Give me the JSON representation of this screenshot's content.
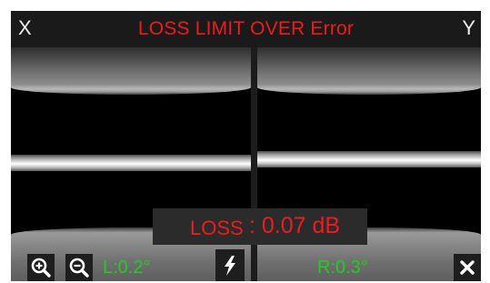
{
  "header": {
    "left_axis": "X",
    "right_axis": "Y",
    "error_title": "LOSS LIMIT OVER Error"
  },
  "loss": {
    "label": "LOSS",
    "value": ": 0.07 dB"
  },
  "bottom": {
    "left_angle": "L:0.2°",
    "right_angle": "R:0.3°"
  },
  "icons": {
    "zoom_in": "zoom-in-icon",
    "zoom_out": "zoom-out-icon",
    "arc": "lightning-icon",
    "close": "close-icon"
  },
  "colors": {
    "error": "#ee1c1c",
    "angle": "#22cc22",
    "panel": "#1a1a1a"
  }
}
